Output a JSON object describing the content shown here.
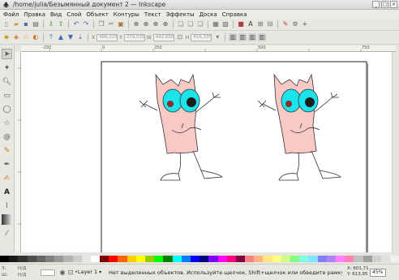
{
  "window": {
    "title": "/home/julia/Безымянный документ 2 — Inkscape"
  },
  "menu": [
    "Файл",
    "Правка",
    "Вид",
    "Слой",
    "Объект",
    "Контуры",
    "Текст",
    "Эффекты",
    "Доска",
    "Справка"
  ],
  "tool_controls": {
    "fields": [
      "486,023",
      "279,035",
      "442,600",
      "416,335"
    ],
    "labels": [
      "X",
      "Y",
      "W",
      "H"
    ]
  },
  "rulers": {
    "h_ticks": [
      "-250",
      "0",
      "250",
      "500",
      "750"
    ]
  },
  "status": {
    "fill_label": "Н/Д",
    "stroke_label": "Н/Д",
    "fill_short": "З:",
    "stroke_short": "Ш:",
    "layer": "•Layer 1",
    "message": "Нет выделенных объектов. Используйте щелчок, Shift+щелчок или обведите рамку во...",
    "x": "X: 601,71",
    "y": "Y: 613,95",
    "zoom": "45%"
  },
  "palette": [
    "#000000",
    "#1a1a1a",
    "#333333",
    "#4d4d4d",
    "#666666",
    "#808080",
    "#999999",
    "#b3b3b3",
    "#cccccc",
    "#e6e6e6",
    "#ffffff",
    "#800000",
    "#ff0000",
    "#ff6600",
    "#ffcc00",
    "#ffff00",
    "#99cc00",
    "#00ff00",
    "#008000",
    "#00ffff",
    "#0080ff",
    "#0000ff",
    "#000080",
    "#8000ff",
    "#ff00ff",
    "#ff0080",
    "#800040",
    "#ff8080",
    "#ffb380",
    "#ffe680",
    "#ffff80",
    "#ccff80",
    "#80ff80",
    "#80ffe6",
    "#80e6ff",
    "#8080ff",
    "#b380ff",
    "#ff80ff",
    "#ff80b3",
    "#c0c0c0",
    "#a0a0a0",
    "#d0d0d0",
    "#e0e0e0",
    "#f0f0f0"
  ],
  "colors": {
    "body_fill": "#f9c9c6",
    "eye_fill": "#1ce4ec",
    "pupil": "#1e1e1e",
    "cheek": "#8a2d2d"
  }
}
